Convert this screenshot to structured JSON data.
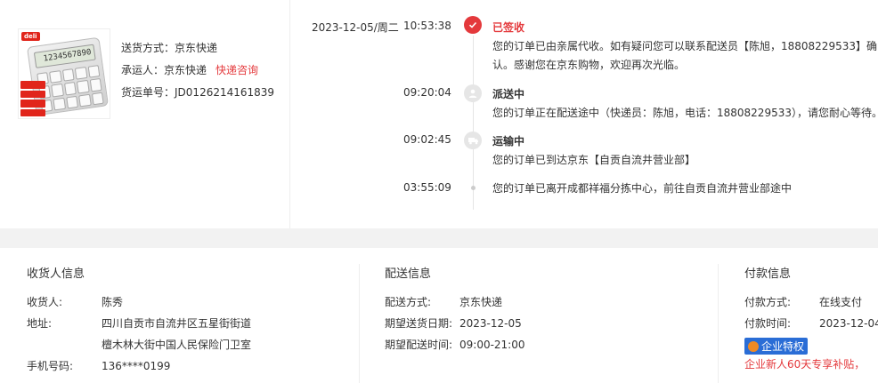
{
  "shipment": {
    "method_label": "送货方式：",
    "method_value": "京东快递",
    "carrier_label": "承运人：",
    "carrier_value": "京东快递",
    "carrier_link": "快递咨询",
    "tracking_label": "货运单号：",
    "tracking_value": "JD0126214161839",
    "product_brand": "deli",
    "calc_display": "1234567890"
  },
  "timeline": {
    "date": "2023-12-05/周二",
    "events": [
      {
        "time": "10:53:38",
        "title": "已签收",
        "desc": "您的订单已由亲属代收。如有疑问您可以联系配送员【陈旭，18808229533】确认。感谢您在京东购物，欢迎再次光临。",
        "icon": "check-icon",
        "state": "active"
      },
      {
        "time": "09:20:04",
        "title": "派送中",
        "desc": "您的订单正在配送途中（快递员：陈旭，电话：18808229533），请您耐心等待。",
        "icon": "courier-icon",
        "state": "gray"
      },
      {
        "time": "09:02:45",
        "title": "运输中",
        "desc": "您的订单已到达京东【自贡自流井营业部】",
        "icon": "truck-icon",
        "state": "gray"
      },
      {
        "time": "03:55:09",
        "title": "",
        "desc": "您的订单已离开成都祥福分拣中心，前往自贡自流井营业部途中",
        "icon": "",
        "state": "dot"
      }
    ]
  },
  "receiver": {
    "heading": "收货人信息",
    "name_label": "收货人:",
    "name_value": "陈秀",
    "addr_label": "地址:",
    "addr_line1": "四川自贡市自流井区五星街街道",
    "addr_line2": "檀木林大街中国人民保险门卫室",
    "phone_label": "手机号码:",
    "phone_value": "136****0199"
  },
  "delivery": {
    "heading": "配送信息",
    "method_label": "配送方式:",
    "method_value": "京东快递",
    "date_label": "期望送货日期:",
    "date_value": "2023-12-05",
    "time_label": "期望配送时间:",
    "time_value": "09:00-21:00"
  },
  "payment": {
    "heading": "付款信息",
    "method_label": "付款方式:",
    "method_value": "在线支付",
    "time_label": "付款时间:",
    "time_value": "2023-12-04",
    "badge": "企业特权",
    "promo": "企业新人60天专享补贴，"
  },
  "colors": {
    "accent": "#e4393c",
    "badge": "#2a6dd6",
    "band": "#f2f2f2"
  }
}
